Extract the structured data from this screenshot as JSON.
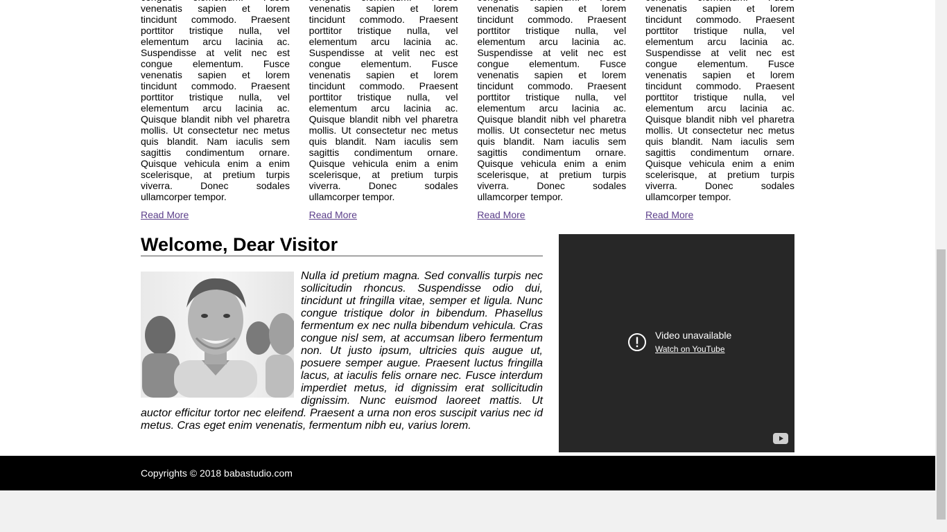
{
  "articles": [
    {
      "text": "congue elementum. Fusce venenatis sapien et lorem tincidunt commodo. Praesent porttitor tristique nulla, vel elementum arcu lacinia ac. Suspendisse at velit nec est congue elementum. Fusce venenatis sapien et lorem tincidunt commodo. Praesent porttitor tristique nulla, vel elementum arcu lacinia ac. Quisque blandit nibh vel pharetra mollis. Ut consectetur nec metus quis blandit. Nam iaculis sem sagittis condimentum ornare. Quisque vehicula enim a enim scelerisque, at pretium turpis viverra. Donec sodales ullamcorper tempor.",
      "link": "Read More"
    },
    {
      "text": "congue elementum. Fusce venenatis sapien et lorem tincidunt commodo. Praesent porttitor tristique nulla, vel elementum arcu lacinia ac. Suspendisse at velit nec est congue elementum. Fusce venenatis sapien et lorem tincidunt commodo. Praesent porttitor tristique nulla, vel elementum arcu lacinia ac. Quisque blandit nibh vel pharetra mollis. Ut consectetur nec metus quis blandit. Nam iaculis sem sagittis condimentum ornare. Quisque vehicula enim a enim scelerisque, at pretium turpis viverra. Donec sodales ullamcorper tempor.",
      "link": "Read More"
    },
    {
      "text": "congue elementum. Fusce venenatis sapien et lorem tincidunt commodo. Praesent porttitor tristique nulla, vel elementum arcu lacinia ac. Suspendisse at velit nec est congue elementum. Fusce venenatis sapien et lorem tincidunt commodo. Praesent porttitor tristique nulla, vel elementum arcu lacinia ac. Quisque blandit nibh vel pharetra mollis. Ut consectetur nec metus quis blandit. Nam iaculis sem sagittis condimentum ornare. Quisque vehicula enim a enim scelerisque, at pretium turpis viverra. Donec sodales ullamcorper tempor.",
      "link": "Read More"
    },
    {
      "text": "congue elementum. Fusce venenatis sapien et lorem tincidunt commodo. Praesent porttitor tristique nulla, vel elementum arcu lacinia ac. Suspendisse at velit nec est congue elementum. Fusce venenatis sapien et lorem tincidunt commodo. Praesent porttitor tristique nulla, vel elementum arcu lacinia ac. Quisque blandit nibh vel pharetra mollis. Ut consectetur nec metus quis blandit. Nam iaculis sem sagittis condimentum ornare. Quisque vehicula enim a enim scelerisque, at pretium turpis viverra. Donec sodales ullamcorper tempor.",
      "link": "Read More"
    }
  ],
  "welcome": {
    "title": "Welcome, Dear Visitor",
    "text": "Nulla id pretium magna. Sed convallis turpis nec sollicitudin rhoncus. Suspendisse odio dui, tincidunt ut fringilla vitae, semper et ligula. Nunc congue tristique dolor in bibendum. Phasellus fermentum ex nec nulla bibendum vehicula. Cras congue nisl sem, at accumsan libero fermentum non. Ut justo ipsum, ultricies quis augue ut, posuere semper augue. Praesent luctus fringilla lacus, at iaculis felis ornare nec. Fusce interdum imperdiet metus, id dignissim erat sollicitudin dignissim. Nunc euismod laoreet mattis. Ut auctor efficitur tortor nec eleifend. Praesent a urna non eros suscipit varius nec id metus. Cras eget enim venenatis, fermentum nibh eu, varius lorem."
  },
  "video": {
    "title": "Video unavailable",
    "link": "Watch on YouTube"
  },
  "footer": {
    "text": "Copyrights © 2018 babastudio.com"
  },
  "colors": {
    "link": "#5b3e8a",
    "footer_bg": "#000000",
    "video_bg": "#272727"
  }
}
